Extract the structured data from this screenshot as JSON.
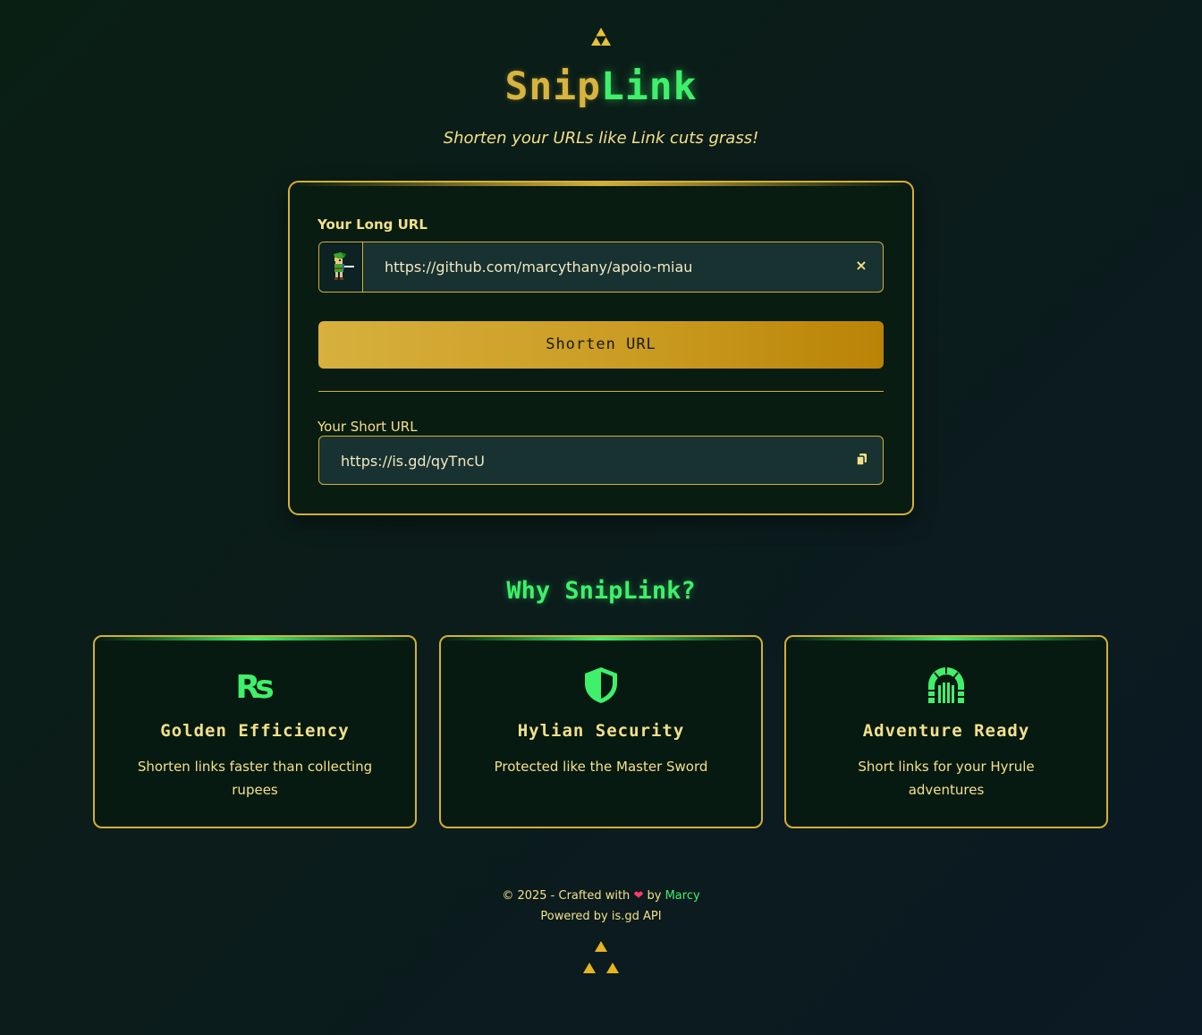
{
  "header": {
    "logo_icon": "triforce-icon",
    "brand_part1": "Snip",
    "brand_part2": "Link",
    "tagline": "Shorten your URLs like Link cuts grass!"
  },
  "form": {
    "long_url_label": "Your Long URL",
    "long_url_value": "https://github.com/marcythany/apoio-miau",
    "input_icon": "link-sprite-icon",
    "clear_label": "×",
    "shorten_label": "Shorten URL",
    "short_url_label": "Your Short URL",
    "short_url_value": "https://is.gd/qyTncU",
    "copy_icon": "copy-icon"
  },
  "why": {
    "title": "Why SnipLink?",
    "features": [
      {
        "icon": "rupee-icon",
        "title": "Golden Efficiency",
        "description": "Shorten links faster than collecting rupees"
      },
      {
        "icon": "shield-icon",
        "title": "Hylian Security",
        "description": "Protected like the Master Sword"
      },
      {
        "icon": "dungeon-door-icon",
        "title": "Adventure Ready",
        "description": "Short links for your Hyrule adventures"
      }
    ]
  },
  "footer": {
    "copyright": "© 2025 - Crafted with",
    "heart": "❤",
    "by": "by",
    "author": "Marcy",
    "powered_by": "Powered by is.gd API",
    "bottom_icon": "triforce-icon"
  },
  "colors": {
    "gold": "#d4af37",
    "green": "#3ff06a",
    "text": "#f3e08a",
    "card_bg": "#081c12",
    "input_bg": "#183131"
  }
}
